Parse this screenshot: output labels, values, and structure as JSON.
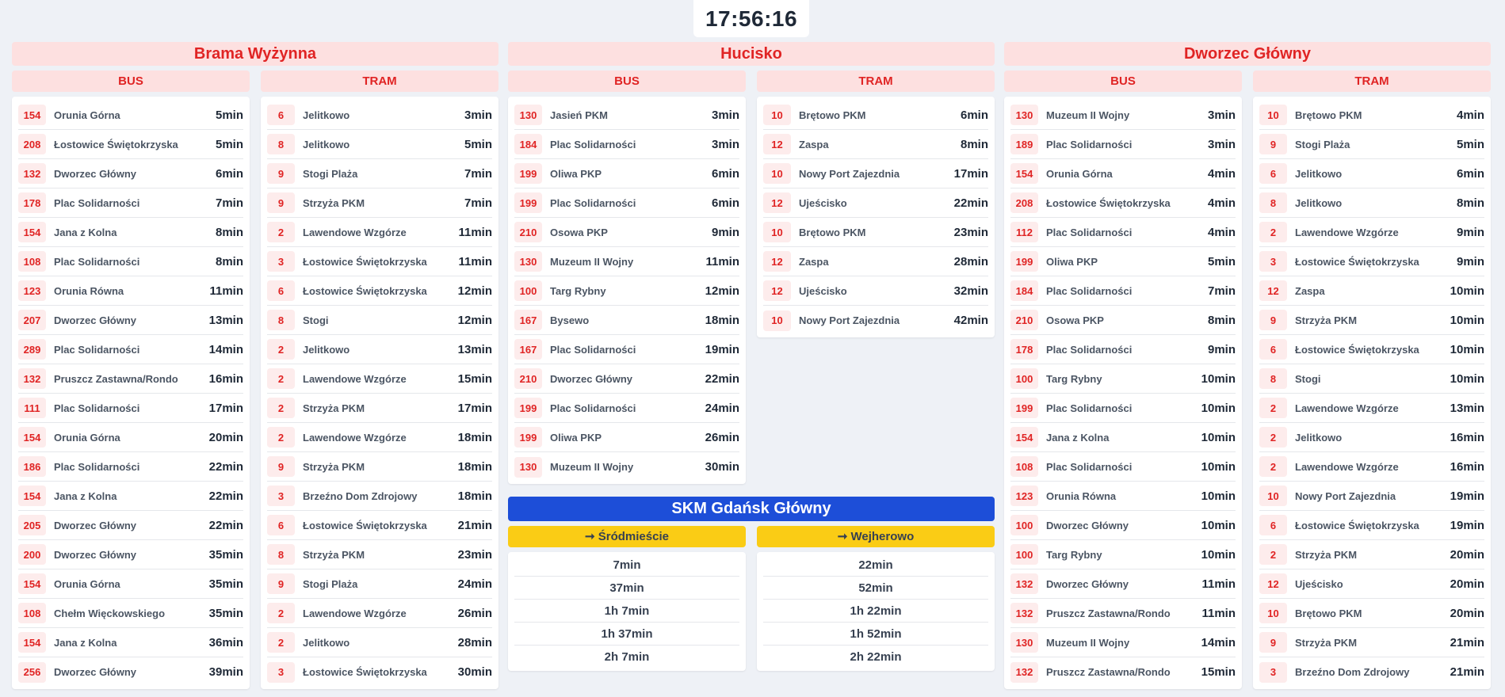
{
  "clock": "17:56:16",
  "stations": [
    {
      "name": "Brama Wyżynna",
      "columns": [
        {
          "label": "BUS",
          "rows": [
            {
              "line": "154",
              "dest": "Orunia Górna",
              "eta": "5min"
            },
            {
              "line": "208",
              "dest": "Łostowice Świętokrzyska",
              "eta": "5min"
            },
            {
              "line": "132",
              "dest": "Dworzec Główny",
              "eta": "6min"
            },
            {
              "line": "178",
              "dest": "Plac Solidarności",
              "eta": "7min"
            },
            {
              "line": "154",
              "dest": "Jana z Kolna",
              "eta": "8min"
            },
            {
              "line": "108",
              "dest": "Plac Solidarności",
              "eta": "8min"
            },
            {
              "line": "123",
              "dest": "Orunia Równa",
              "eta": "11min"
            },
            {
              "line": "207",
              "dest": "Dworzec Główny",
              "eta": "13min"
            },
            {
              "line": "289",
              "dest": "Plac Solidarności",
              "eta": "14min"
            },
            {
              "line": "132",
              "dest": "Pruszcz Zastawna/Rondo",
              "eta": "16min"
            },
            {
              "line": "111",
              "dest": "Plac Solidarności",
              "eta": "17min"
            },
            {
              "line": "154",
              "dest": "Orunia Górna",
              "eta": "20min"
            },
            {
              "line": "186",
              "dest": "Plac Solidarności",
              "eta": "22min"
            },
            {
              "line": "154",
              "dest": "Jana z Kolna",
              "eta": "22min"
            },
            {
              "line": "205",
              "dest": "Dworzec Główny",
              "eta": "22min"
            },
            {
              "line": "200",
              "dest": "Dworzec Główny",
              "eta": "35min"
            },
            {
              "line": "154",
              "dest": "Orunia Górna",
              "eta": "35min"
            },
            {
              "line": "108",
              "dest": "Chełm Więckowskiego",
              "eta": "35min"
            },
            {
              "line": "154",
              "dest": "Jana z Kolna",
              "eta": "36min"
            },
            {
              "line": "256",
              "dest": "Dworzec Główny",
              "eta": "39min"
            }
          ]
        },
        {
          "label": "TRAM",
          "rows": [
            {
              "line": "6",
              "dest": "Jelitkowo",
              "eta": "3min"
            },
            {
              "line": "8",
              "dest": "Jelitkowo",
              "eta": "5min"
            },
            {
              "line": "9",
              "dest": "Stogi Plaża",
              "eta": "7min"
            },
            {
              "line": "9",
              "dest": "Strzyża PKM",
              "eta": "7min"
            },
            {
              "line": "2",
              "dest": "Lawendowe Wzgórze",
              "eta": "11min"
            },
            {
              "line": "3",
              "dest": "Łostowice Świętokrzyska",
              "eta": "11min"
            },
            {
              "line": "6",
              "dest": "Łostowice Świętokrzyska",
              "eta": "12min"
            },
            {
              "line": "8",
              "dest": "Stogi",
              "eta": "12min"
            },
            {
              "line": "2",
              "dest": "Jelitkowo",
              "eta": "13min"
            },
            {
              "line": "2",
              "dest": "Lawendowe Wzgórze",
              "eta": "15min"
            },
            {
              "line": "2",
              "dest": "Strzyża PKM",
              "eta": "17min"
            },
            {
              "line": "2",
              "dest": "Lawendowe Wzgórze",
              "eta": "18min"
            },
            {
              "line": "9",
              "dest": "Strzyża PKM",
              "eta": "18min"
            },
            {
              "line": "3",
              "dest": "Brzeźno Dom Zdrojowy",
              "eta": "18min"
            },
            {
              "line": "6",
              "dest": "Łostowice Świętokrzyska",
              "eta": "21min"
            },
            {
              "line": "8",
              "dest": "Strzyża PKM",
              "eta": "23min"
            },
            {
              "line": "9",
              "dest": "Stogi Plaża",
              "eta": "24min"
            },
            {
              "line": "2",
              "dest": "Lawendowe Wzgórze",
              "eta": "26min"
            },
            {
              "line": "2",
              "dest": "Jelitkowo",
              "eta": "28min"
            },
            {
              "line": "3",
              "dest": "Łostowice Świętokrzyska",
              "eta": "30min"
            }
          ]
        }
      ]
    },
    {
      "name": "Hucisko",
      "columns": [
        {
          "label": "BUS",
          "rows": [
            {
              "line": "130",
              "dest": "Jasień PKM",
              "eta": "3min"
            },
            {
              "line": "184",
              "dest": "Plac Solidarności",
              "eta": "3min"
            },
            {
              "line": "199",
              "dest": "Oliwa PKP",
              "eta": "6min"
            },
            {
              "line": "199",
              "dest": "Plac Solidarności",
              "eta": "6min"
            },
            {
              "line": "210",
              "dest": "Osowa PKP",
              "eta": "9min"
            },
            {
              "line": "130",
              "dest": "Muzeum II Wojny",
              "eta": "11min"
            },
            {
              "line": "100",
              "dest": "Targ Rybny",
              "eta": "12min"
            },
            {
              "line": "167",
              "dest": "Bysewo",
              "eta": "18min"
            },
            {
              "line": "167",
              "dest": "Plac Solidarności",
              "eta": "19min"
            },
            {
              "line": "210",
              "dest": "Dworzec Główny",
              "eta": "22min"
            },
            {
              "line": "199",
              "dest": "Plac Solidarności",
              "eta": "24min"
            },
            {
              "line": "199",
              "dest": "Oliwa PKP",
              "eta": "26min"
            },
            {
              "line": "130",
              "dest": "Muzeum II Wojny",
              "eta": "30min"
            }
          ]
        },
        {
          "label": "TRAM",
          "rows": [
            {
              "line": "10",
              "dest": "Brętowo PKM",
              "eta": "6min"
            },
            {
              "line": "12",
              "dest": "Zaspa",
              "eta": "8min"
            },
            {
              "line": "10",
              "dest": "Nowy Port Zajezdnia",
              "eta": "17min"
            },
            {
              "line": "12",
              "dest": "Ujeścisko",
              "eta": "22min"
            },
            {
              "line": "10",
              "dest": "Brętowo PKM",
              "eta": "23min"
            },
            {
              "line": "12",
              "dest": "Zaspa",
              "eta": "28min"
            },
            {
              "line": "12",
              "dest": "Ujeścisko",
              "eta": "32min"
            },
            {
              "line": "10",
              "dest": "Nowy Port Zajezdnia",
              "eta": "42min"
            }
          ]
        }
      ]
    },
    {
      "name": "Dworzec Główny",
      "columns": [
        {
          "label": "BUS",
          "rows": [
            {
              "line": "130",
              "dest": "Muzeum II Wojny",
              "eta": "3min"
            },
            {
              "line": "189",
              "dest": "Plac Solidarności",
              "eta": "3min"
            },
            {
              "line": "154",
              "dest": "Orunia Górna",
              "eta": "4min"
            },
            {
              "line": "208",
              "dest": "Łostowice Świętokrzyska",
              "eta": "4min"
            },
            {
              "line": "112",
              "dest": "Plac Solidarności",
              "eta": "4min"
            },
            {
              "line": "199",
              "dest": "Oliwa PKP",
              "eta": "5min"
            },
            {
              "line": "184",
              "dest": "Plac Solidarności",
              "eta": "7min"
            },
            {
              "line": "210",
              "dest": "Osowa PKP",
              "eta": "8min"
            },
            {
              "line": "178",
              "dest": "Plac Solidarności",
              "eta": "9min"
            },
            {
              "line": "100",
              "dest": "Targ Rybny",
              "eta": "10min"
            },
            {
              "line": "199",
              "dest": "Plac Solidarności",
              "eta": "10min"
            },
            {
              "line": "154",
              "dest": "Jana z Kolna",
              "eta": "10min"
            },
            {
              "line": "108",
              "dest": "Plac Solidarności",
              "eta": "10min"
            },
            {
              "line": "123",
              "dest": "Orunia Równa",
              "eta": "10min"
            },
            {
              "line": "100",
              "dest": "Dworzec Główny",
              "eta": "10min"
            },
            {
              "line": "100",
              "dest": "Targ Rybny",
              "eta": "10min"
            },
            {
              "line": "132",
              "dest": "Dworzec Główny",
              "eta": "11min"
            },
            {
              "line": "132",
              "dest": "Pruszcz Zastawna/Rondo",
              "eta": "11min"
            },
            {
              "line": "130",
              "dest": "Muzeum II Wojny",
              "eta": "14min"
            },
            {
              "line": "132",
              "dest": "Pruszcz Zastawna/Rondo",
              "eta": "15min"
            }
          ]
        },
        {
          "label": "TRAM",
          "rows": [
            {
              "line": "10",
              "dest": "Brętowo PKM",
              "eta": "4min"
            },
            {
              "line": "9",
              "dest": "Stogi Plaża",
              "eta": "5min"
            },
            {
              "line": "6",
              "dest": "Jelitkowo",
              "eta": "6min"
            },
            {
              "line": "8",
              "dest": "Jelitkowo",
              "eta": "8min"
            },
            {
              "line": "2",
              "dest": "Lawendowe Wzgórze",
              "eta": "9min"
            },
            {
              "line": "3",
              "dest": "Łostowice Świętokrzyska",
              "eta": "9min"
            },
            {
              "line": "12",
              "dest": "Zaspa",
              "eta": "10min"
            },
            {
              "line": "9",
              "dest": "Strzyża PKM",
              "eta": "10min"
            },
            {
              "line": "6",
              "dest": "Łostowice Świętokrzyska",
              "eta": "10min"
            },
            {
              "line": "8",
              "dest": "Stogi",
              "eta": "10min"
            },
            {
              "line": "2",
              "dest": "Lawendowe Wzgórze",
              "eta": "13min"
            },
            {
              "line": "2",
              "dest": "Jelitkowo",
              "eta": "16min"
            },
            {
              "line": "2",
              "dest": "Lawendowe Wzgórze",
              "eta": "16min"
            },
            {
              "line": "10",
              "dest": "Nowy Port Zajezdnia",
              "eta": "19min"
            },
            {
              "line": "6",
              "dest": "Łostowice Świętokrzyska",
              "eta": "19min"
            },
            {
              "line": "2",
              "dest": "Strzyża PKM",
              "eta": "20min"
            },
            {
              "line": "12",
              "dest": "Ujeścisko",
              "eta": "20min"
            },
            {
              "line": "10",
              "dest": "Brętowo PKM",
              "eta": "20min"
            },
            {
              "line": "9",
              "dest": "Strzyża PKM",
              "eta": "21min"
            },
            {
              "line": "3",
              "dest": "Brzeźno Dom Zdrojowy",
              "eta": "21min"
            }
          ]
        }
      ]
    }
  ],
  "skm": {
    "title": "SKM Gdańsk Główny",
    "directions": [
      {
        "label": "➞ Śródmieście",
        "times": [
          "7min",
          "37min",
          "1h 7min",
          "1h 37min",
          "2h 7min"
        ]
      },
      {
        "label": "➞ Wejherowo",
        "times": [
          "22min",
          "52min",
          "1h 22min",
          "1h 52min",
          "2h 22min"
        ]
      }
    ]
  },
  "colors": {
    "background": "#eef1f6",
    "accent_red": "#e02424",
    "header_pink": "#fde0e0",
    "skm_blue": "#1d4ed8",
    "skm_yellow": "#facc15"
  }
}
